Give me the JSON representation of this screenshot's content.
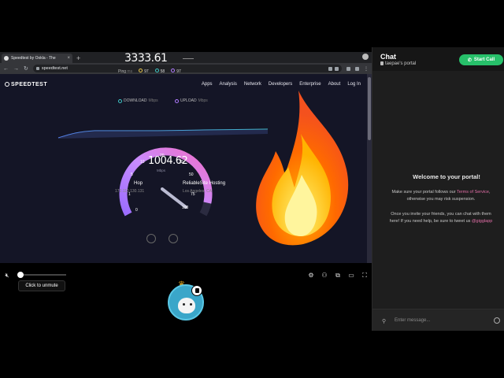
{
  "browser": {
    "tab_title": "Speedtest by Ookla - The",
    "tab_close": "×",
    "new_tab": "+",
    "url": "speedtest.net"
  },
  "speedtest": {
    "logo": "SPEEDTEST",
    "nav": [
      "Apps",
      "Analysis",
      "Network",
      "Developers",
      "Enterprise",
      "About",
      "Log In"
    ],
    "download_label": "DOWNLOAD",
    "upload_label": "UPLOAD",
    "unit": "Mbps",
    "download_value": "3333.61",
    "ping_label": "Ping",
    "ping_unit": "ms",
    "ping_values": [
      "97",
      "58",
      "97"
    ],
    "gauge_ticks": [
      "0",
      "1",
      "5",
      "10",
      "20",
      "30",
      "50",
      "75",
      "100"
    ],
    "gauge_level": 0.93,
    "current_speed": "1004.62",
    "hop_label": "Hop",
    "hop_ip": "172.110.130.131",
    "host_name": "ReliableSite Hosting",
    "host_location": "Los Angeles, CA"
  },
  "controls": {
    "tooltip": "Click to unmute",
    "volume_level": 0
  },
  "chat": {
    "title": "Chat",
    "portal_name": "taepae's portal",
    "call_button": "Start Call",
    "welcome": "Welcome to your portal!",
    "line1": "Make sure your portal follows our",
    "tos": "Terms of Service",
    "line1_end": ",",
    "line2": "otherwise you may risk suspension.",
    "line3": "Once you invite your friends, you can chat with them",
    "line4": "here! If you need help, be sure to tweet us",
    "handle": "@gigglapp",
    "placeholder": "Enter message..."
  },
  "colors": {
    "accent_green": "#27c06a",
    "link_pink": "#e36fa8",
    "gauge_start": "#5b8cff",
    "gauge_end": "#f06fc8"
  }
}
